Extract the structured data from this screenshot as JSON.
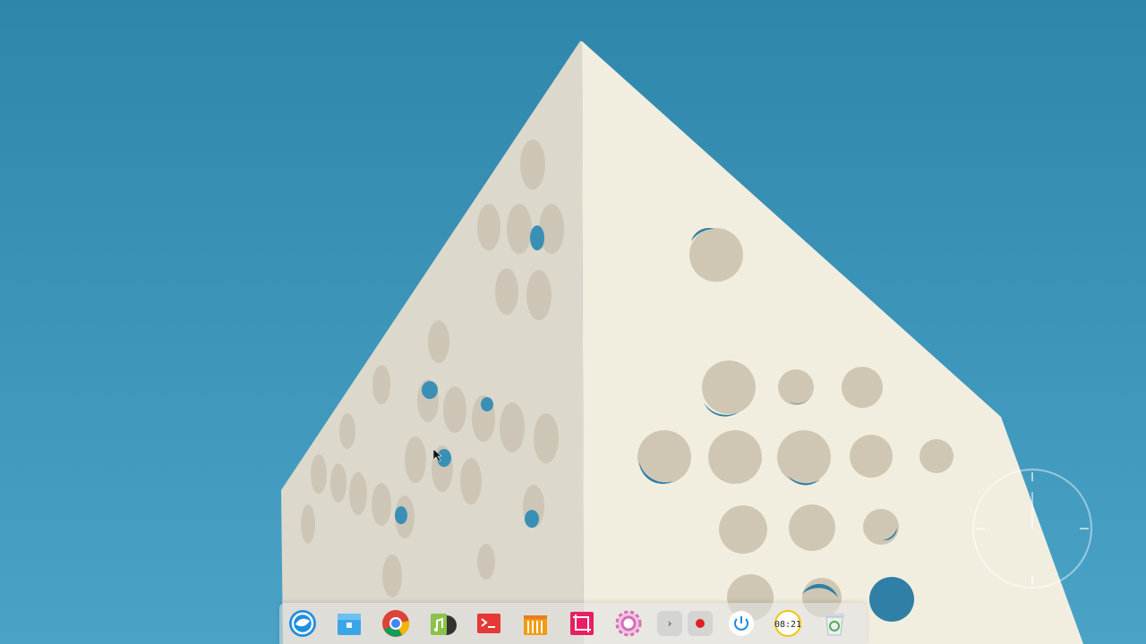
{
  "desktop": {
    "wallpaper": "sky-with-perforated-building",
    "sky_color": "#3a92b7",
    "building_color": "#efeadb"
  },
  "dock": {
    "items": [
      {
        "name": "launcher",
        "icon": "deepin-launcher-icon"
      },
      {
        "name": "file-manager",
        "icon": "folder-icon"
      },
      {
        "name": "browser",
        "icon": "chrome-icon"
      },
      {
        "name": "music",
        "icon": "music-icon"
      },
      {
        "name": "terminal",
        "icon": "terminal-icon"
      },
      {
        "name": "app-store",
        "icon": "store-bag-icon"
      },
      {
        "name": "screenshot",
        "icon": "crop-icon"
      },
      {
        "name": "settings",
        "icon": "settings-gear-icon"
      }
    ],
    "tray": {
      "expand_label": "›",
      "record_icon": "record-icon"
    },
    "power_icon": "power-icon",
    "clock_text": "08:21",
    "trash_icon": "trash-icon"
  }
}
